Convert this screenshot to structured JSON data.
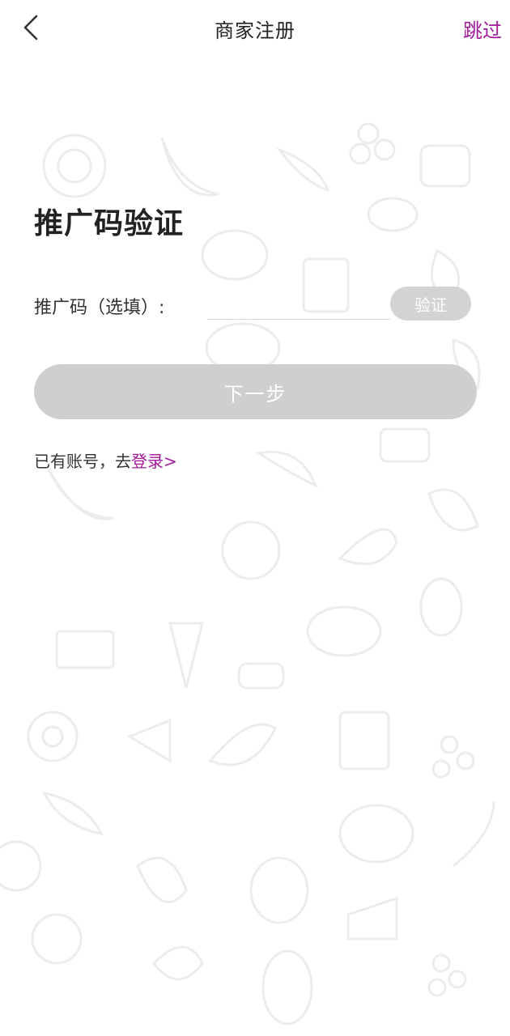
{
  "header": {
    "title": "商家注册",
    "skip_label": "跳过",
    "back_icon": "chevron-left-icon"
  },
  "form": {
    "section_title": "推广码验证",
    "code_label": "推广码（选填）:",
    "code_value": "",
    "verify_label": "验证",
    "next_label": "下一步"
  },
  "footer": {
    "login_prefix": "已有账号，去",
    "login_link": "登录>"
  },
  "colors": {
    "accent": "#a0189a",
    "disabled_button": "#cfcfcf"
  }
}
